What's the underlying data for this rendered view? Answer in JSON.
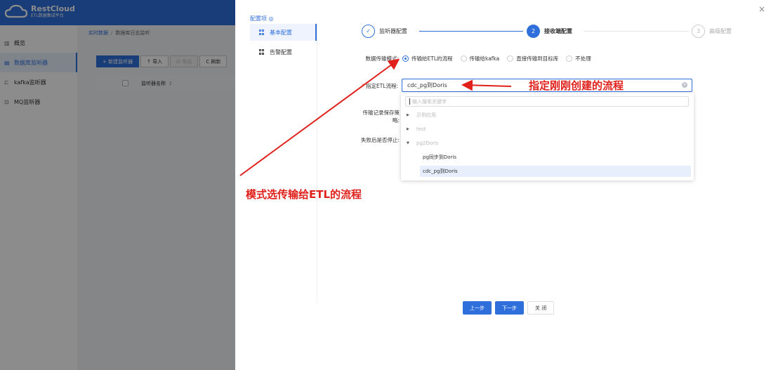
{
  "app": {
    "logo_name": "RestCloud",
    "logo_sub": "ETL数据集成平台"
  },
  "sidebar": {
    "items": [
      {
        "label": "概览",
        "icon": "bar-chart-icon"
      },
      {
        "label": "数据库监听器",
        "icon": "database-icon",
        "active": true
      },
      {
        "label": "kafka监听器",
        "icon": "kafka-icon"
      },
      {
        "label": "MQ监听器",
        "icon": "mq-icon"
      }
    ]
  },
  "breadcrumb": {
    "root": "实时数据",
    "current": "数据库日志监听"
  },
  "toolbar": {
    "new_label": "+ 新建监听器",
    "import_label": "↑ 导入",
    "export_label": "⊟ 导出",
    "refresh_label": "C 刷新"
  },
  "table": {
    "col_name": "监听器名称"
  },
  "drawer": {
    "close_icon": "×",
    "config_title": "配置项 ◎",
    "menu": [
      {
        "label": "基本配置",
        "active": true
      },
      {
        "label": "告警配置",
        "active": false
      }
    ],
    "steps": [
      {
        "num": "✓",
        "label": "监听器配置",
        "state": "done"
      },
      {
        "num": "2",
        "label": "接收端配置",
        "state": "active"
      },
      {
        "num": "3",
        "label": "高级配置",
        "state": "pending"
      }
    ],
    "form": {
      "mode_label": "数据传输模式:",
      "mode_options": [
        {
          "label": "传输给ETL的流程",
          "checked": true
        },
        {
          "label": "传输给kafka",
          "checked": false
        },
        {
          "label": "直接传输到目标库",
          "checked": false
        },
        {
          "label": "不处理",
          "checked": false
        }
      ],
      "etl_label": "指定ETL流程:",
      "etl_value": "cdc_pg到Doris",
      "save_label": "传输记录保存策略:",
      "stop_label": "失败后是否停止:"
    },
    "dropdown": {
      "search_placeholder": "输入搜索关键字",
      "nodes": [
        {
          "label": "示例应用",
          "type": "group",
          "expanded": false
        },
        {
          "label": "test",
          "type": "group",
          "expanded": false
        },
        {
          "label": "pg2Doris",
          "type": "group",
          "expanded": true
        },
        {
          "label": "pg同步到Doris",
          "type": "leaf",
          "selected": false
        },
        {
          "label": "cdc_pg到Doris",
          "type": "leaf",
          "selected": true
        }
      ]
    },
    "annotations": {
      "etl_note": "指定刚刚创建的流程",
      "mode_note": "模式选传输给ETL的流程"
    },
    "footer": {
      "prev": "上一步",
      "next": "下一步",
      "close": "关 闭"
    }
  },
  "colors": {
    "primary": "#2f6fdc",
    "annotation": "#e0201b"
  }
}
